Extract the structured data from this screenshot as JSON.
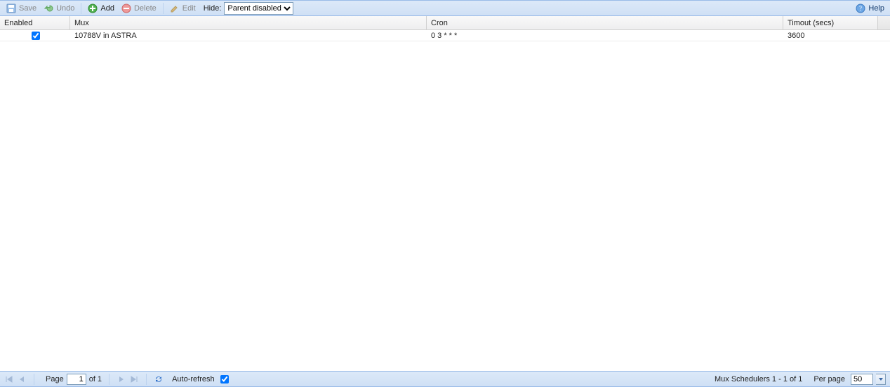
{
  "toolbar": {
    "save": "Save",
    "undo": "Undo",
    "add": "Add",
    "delete": "Delete",
    "edit": "Edit",
    "hide_label": "Hide:",
    "hide_selected": "Parent disabled",
    "help": "Help"
  },
  "columns": {
    "enabled": "Enabled",
    "mux": "Mux",
    "cron": "Cron",
    "timeout": "Timout (secs)"
  },
  "rows": [
    {
      "enabled": true,
      "mux": "10788V in ASTRA",
      "cron": "0 3 * * *",
      "timeout": "3600"
    }
  ],
  "pager": {
    "page_label": "Page",
    "page": "1",
    "of_label": "of 1",
    "auto_refresh_label": "Auto-refresh",
    "auto_refresh_checked": true,
    "status": "Mux Schedulers 1 - 1 of 1",
    "per_page_label": "Per page",
    "per_page": "50"
  }
}
